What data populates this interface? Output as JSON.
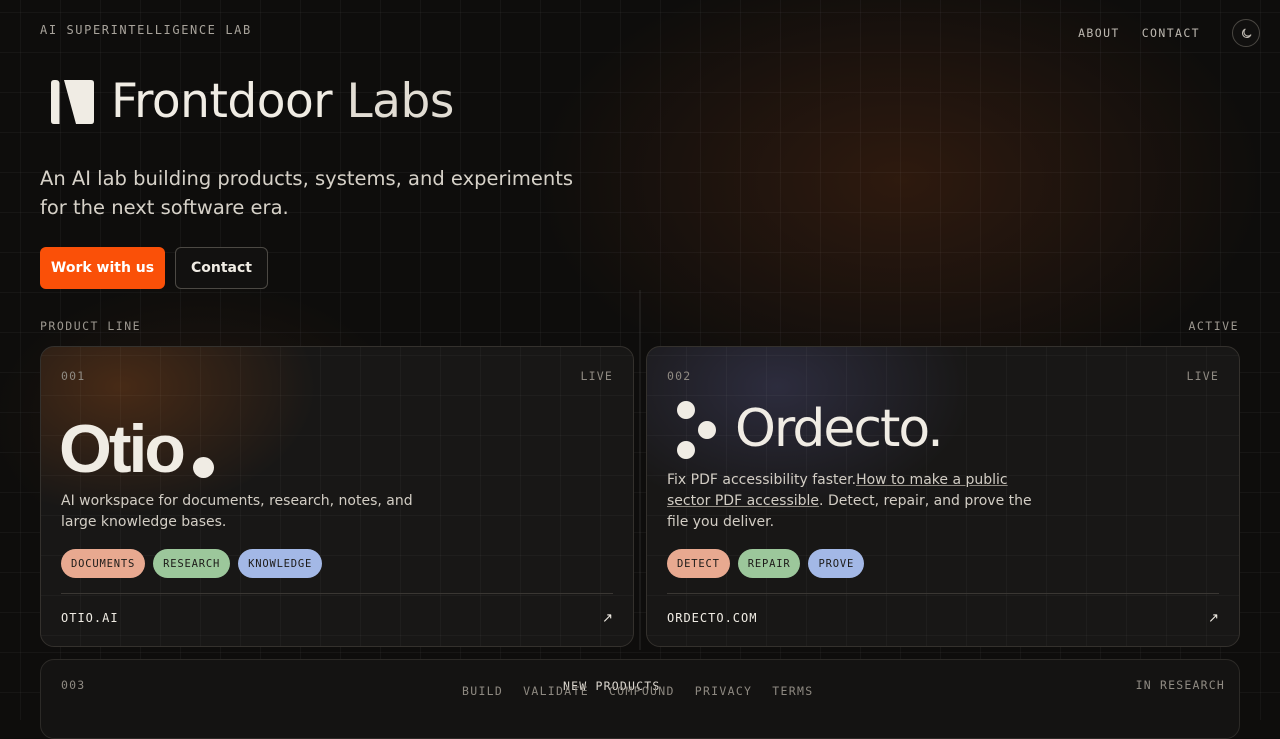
{
  "header": {
    "kicker": "AI SUPERINTELLIGENCE LAB",
    "nav": {
      "about": "ABOUT",
      "contact": "CONTACT"
    },
    "theme_toggle_icon": "moon-icon"
  },
  "hero": {
    "brand_name": "Frontdoor",
    "brand_suffix": "Labs",
    "tagline": "An AI lab building products, systems, and experiments for the next software era.",
    "primary_cta": "Work with us",
    "secondary_cta": "Contact"
  },
  "products": {
    "section_label": "PRODUCT LINE",
    "section_status": "ACTIVE",
    "cards": [
      {
        "number": "001",
        "status": "LIVE",
        "name": "Otio",
        "description": "AI workspace for documents, research, notes, and large knowledge bases.",
        "tags": [
          "DOCUMENTS",
          "RESEARCH",
          "KNOWLEDGE"
        ],
        "link": "OTIO.AI",
        "arrow": "↗"
      },
      {
        "number": "002",
        "status": "LIVE",
        "name": "Ordecto.",
        "description_start": "Fix PDF accessibility faster.",
        "description_link": "How to make a public sector PDF accessible",
        "description_end": ". Detect, repair, and prove the file you deliver.",
        "tags": [
          "DETECT",
          "REPAIR",
          "PROVE"
        ],
        "link": "ORDECTO.COM",
        "arrow": "↗"
      },
      {
        "number": "003",
        "status": "IN RESEARCH",
        "title": "NEW PRODUCTS"
      }
    ]
  },
  "footer": {
    "links": [
      "BUILD",
      "VALIDATE",
      "COMPOUND",
      "PRIVACY",
      "TERMS"
    ]
  },
  "colors": {
    "accent": "#fa5008",
    "background": "#0e0d0c",
    "tag_peach": "#e8a990",
    "tag_green": "#9cc79b",
    "tag_blue": "#a3b8e6"
  }
}
